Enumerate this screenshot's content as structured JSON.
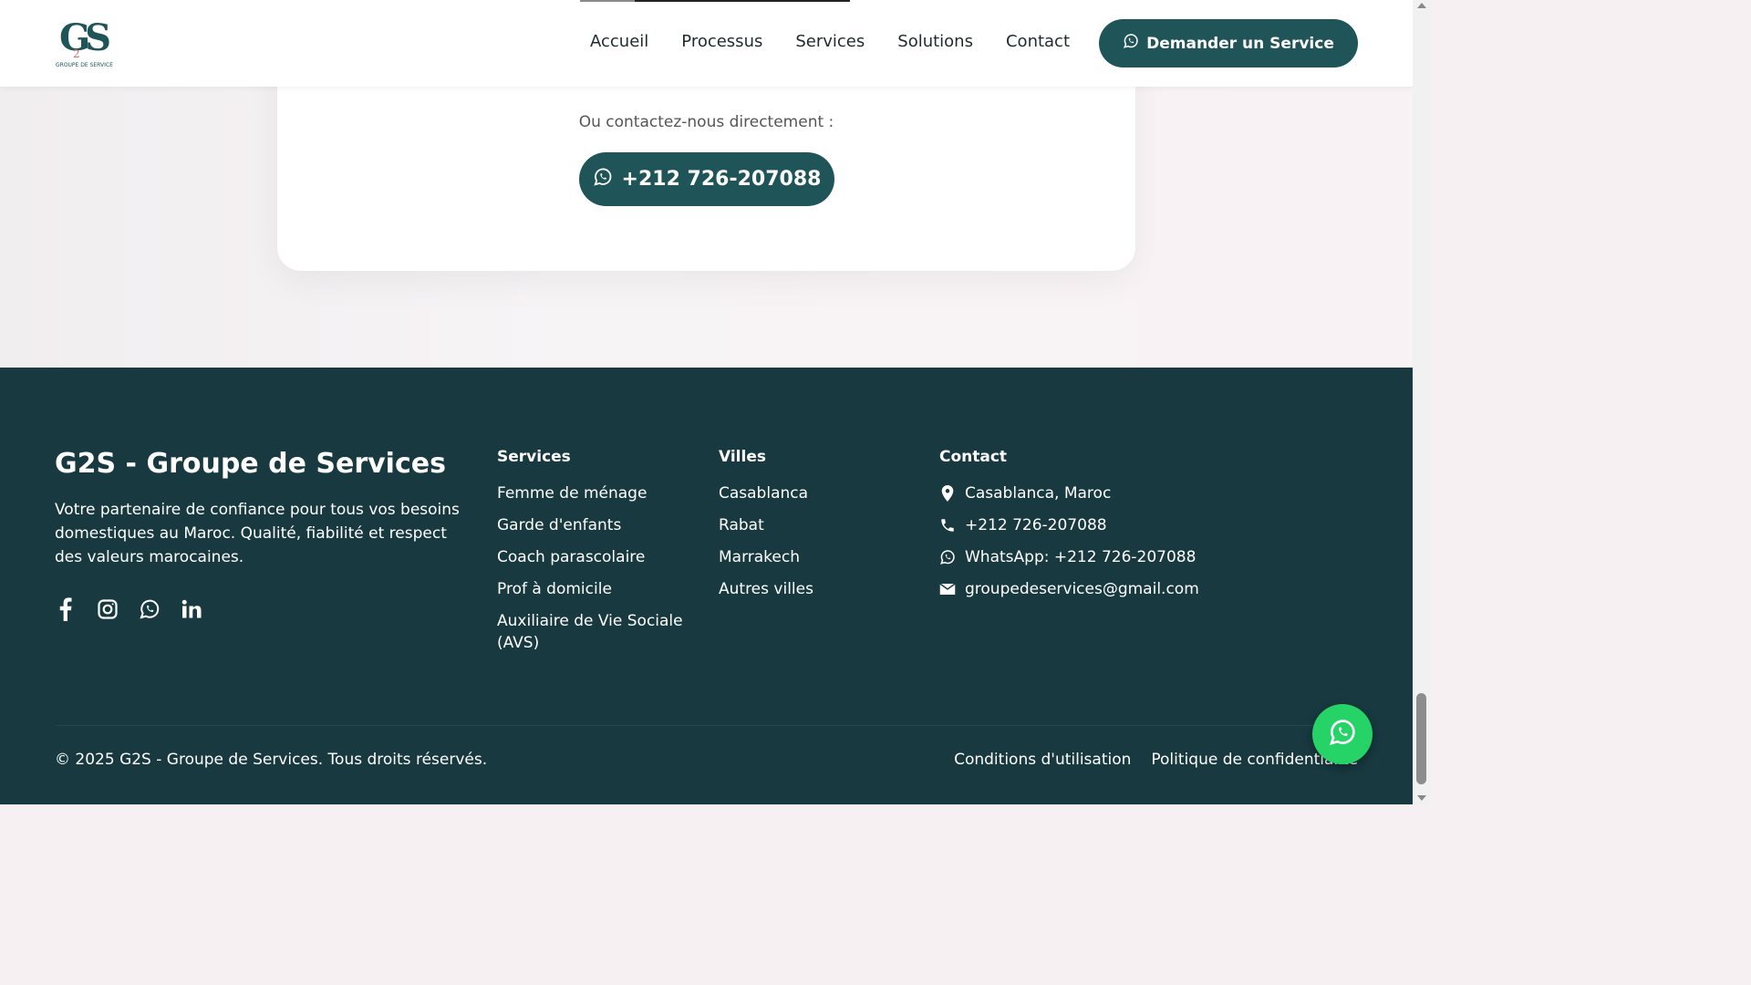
{
  "header": {
    "logo_text": "GS",
    "logo_two": "2",
    "logo_sub": "GROUPE DE SERVICE",
    "nav": [
      "Accueil",
      "Processus",
      "Services",
      "Solutions",
      "Contact"
    ],
    "cta_label": "Demander un Service"
  },
  "contact_card": {
    "direct_text": "Ou contactez-nous directement :",
    "phone_label": "+212 726-207088"
  },
  "footer": {
    "brand_title": "G2S - Groupe de Services",
    "brand_desc": "Votre partenaire de confiance pour tous vos besoins domestiques au Maroc. Qualité, fiabilité et respect des valeurs marocaines.",
    "socials": [
      "facebook-icon",
      "instagram-icon",
      "whatsapp-icon",
      "linkedin-icon"
    ],
    "services": {
      "title": "Services",
      "items": [
        "Femme de ménage",
        "Garde d'enfants",
        "Coach parascolaire",
        "Prof à domicile",
        "Auxiliaire de Vie Sociale (AVS)"
      ]
    },
    "villes": {
      "title": "Villes",
      "items": [
        "Casablanca",
        "Rabat",
        "Marrakech",
        "Autres villes"
      ]
    },
    "contact": {
      "title": "Contact",
      "location": "Casablanca, Maroc",
      "phone": "+212 726-207088",
      "whatsapp": "WhatsApp: +212 726-207088",
      "email": "groupedeservices@gmail.com"
    },
    "copyright": "© 2025 G2S - Groupe de Services. Tous droits réservés.",
    "legal": [
      "Conditions d'utilisation",
      "Politique de confidentialité"
    ]
  },
  "colors": {
    "primary": "#1f5458",
    "footer_bg": "#17393f",
    "whatsapp_green": "#25d366"
  }
}
